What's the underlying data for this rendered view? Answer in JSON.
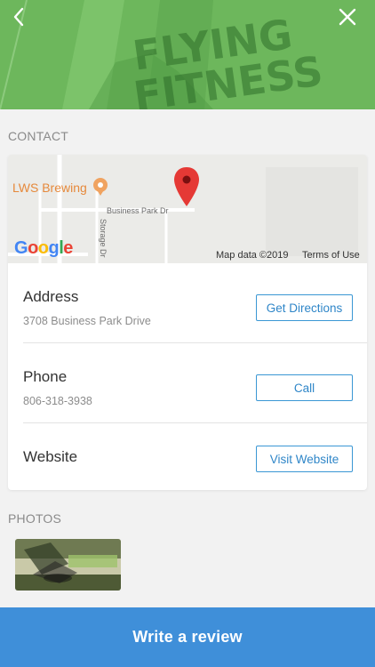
{
  "hero": {
    "banner_text_top": "FLYING",
    "banner_text_bottom": "FITNESS"
  },
  "sections": {
    "contact": "CONTACT",
    "photos": "PHOTOS"
  },
  "map": {
    "poi_name": "LWS Brewing",
    "street_name": "Business Park Dr",
    "side_street": "Storage Dr",
    "logo_text": "Google",
    "attribution": "Map data ©2019",
    "terms": "Terms of Use"
  },
  "contact": {
    "address": {
      "title": "Address",
      "value": "3708 Business Park Drive",
      "button": "Get Directions"
    },
    "phone": {
      "title": "Phone",
      "value": "806-318-3938",
      "button": "Call"
    },
    "website": {
      "title": "Website",
      "button": "Visit Website"
    }
  },
  "footer": {
    "write_review": "Write a review"
  },
  "colors": {
    "accent": "#3a97d4",
    "review_bar": "#3f8fd9",
    "pin": "#e53935",
    "poi": "#e6893b"
  }
}
